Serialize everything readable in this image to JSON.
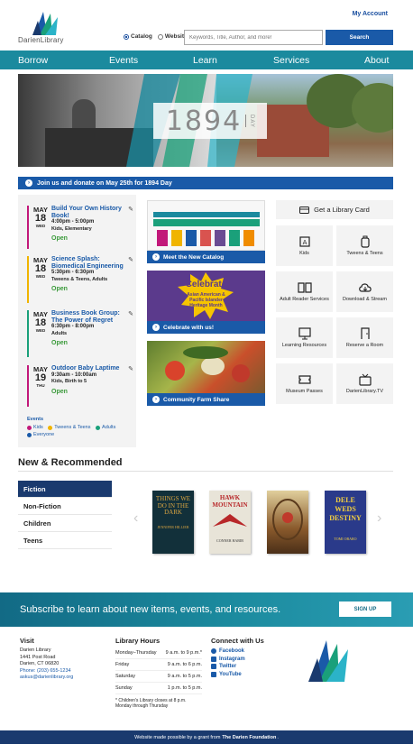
{
  "header": {
    "my_account": "My Account",
    "logo_text": "DarienLibrary",
    "radio_catalog": "Catalog",
    "radio_website": "Website",
    "search_placeholder": "Keywords, Title, Author, and more!",
    "search_button": "Search"
  },
  "nav": [
    "Borrow",
    "Events",
    "Learn",
    "Services",
    "About"
  ],
  "hero": {
    "year": "1894",
    "day": "DAY"
  },
  "announcement": "Join us and donate on May 25th for 1894 Day",
  "events": [
    {
      "month": "MAY",
      "day": "18",
      "dow": "WED",
      "title": "Build Your Own History Book!",
      "time": "4:00pm - 5:00pm",
      "audience": "Kids, Elementary",
      "status": "Open",
      "color": "#c2187a"
    },
    {
      "month": "MAY",
      "day": "18",
      "dow": "WED",
      "title": "Science Splash: Biomedical Engineering",
      "time": "5:30pm - 6:30pm",
      "audience": "Tweens & Teens, Adults",
      "status": "Open",
      "color": "#f0b400"
    },
    {
      "month": "MAY",
      "day": "18",
      "dow": "WED",
      "title": "Business Book Group: The Power of Regret",
      "time": "6:30pm - 8:00pm",
      "audience": "Adults",
      "status": "Open",
      "color": "#1aa07a"
    },
    {
      "month": "MAY",
      "day": "19",
      "dow": "THU",
      "title": "Outdoor Baby Laptime",
      "time": "9:30am - 10:00am",
      "audience": "Kids, Birth to 5",
      "status": "Open",
      "color": "#c2187a"
    }
  ],
  "legend": {
    "title": "Events",
    "items": [
      {
        "label": "Kids",
        "color": "#c2187a"
      },
      {
        "label": "Tweens & Teens",
        "color": "#f0b400"
      },
      {
        "label": "Adults",
        "color": "#1aa07a"
      },
      {
        "label": "Everyone",
        "color": "#1a5aa8"
      }
    ]
  },
  "promos": {
    "catalog": "Meet the New Catalog",
    "celebrate": "Celebrate with us!",
    "celebrate_title": "Celebrate",
    "celebrate_sub": "Asian American & Pacific Islander Heritage Month",
    "farm": "Community Farm Share"
  },
  "quicklinks": {
    "card": "Get a Library Card",
    "items": [
      "Kids",
      "Tweens & Teens",
      "Adult Reader Services",
      "Download & Stream",
      "Learning Resources",
      "Reserve a Room",
      "Museum Passes",
      "DarienLibrary.TV"
    ]
  },
  "new_rec": {
    "title": "New & Recommended",
    "categories": [
      "Fiction",
      "Non-Fiction",
      "Children",
      "Teens"
    ],
    "books": [
      {
        "title": "THINGS WE DO IN THE DARK",
        "author": "JENNIFER HILLIER"
      },
      {
        "title": "HAWK MOUNTAIN",
        "author": "CONNER HABIB"
      },
      {
        "title": "",
        "author": ""
      },
      {
        "title": "DELE WEDS DESTINY",
        "author": "TOMI OBARO"
      }
    ]
  },
  "subscribe": {
    "text": "Subscribe to learn about new items, events, and resources.",
    "button": "SIGN UP"
  },
  "footer": {
    "visit": {
      "heading": "Visit",
      "name": "Darien Library",
      "street": "1441 Post Road",
      "city": "Darien, CT 06820",
      "phone": "Phone: (203) 655-1234",
      "email": "askus@darienlibrary.org"
    },
    "hours": {
      "heading": "Library Hours",
      "rows": [
        {
          "day": "Monday–Thursday",
          "time": "9 a.m. to 9 p.m.*"
        },
        {
          "day": "Friday",
          "time": "9 a.m. to 6 p.m."
        },
        {
          "day": "Saturday",
          "time": "9 a.m. to 5 p.m."
        },
        {
          "day": "Sunday",
          "time": "1 p.m. to 5 p.m."
        }
      ],
      "note": "* Children's Library closes at 8 p.m. Monday through Thursday"
    },
    "connect": {
      "heading": "Connect with Us",
      "links": [
        "Facebook",
        "Instagram",
        "Twitter",
        "YouTube"
      ]
    },
    "credit_prefix": "Website made possible by a grant from",
    "credit_org": "The Darien Foundation",
    "credit_suffix": "."
  },
  "colors": {
    "teal": "#1b8a9e",
    "blue": "#1a5aa8",
    "navy": "#1a3a6e",
    "green_open": "#3a9a3a"
  }
}
